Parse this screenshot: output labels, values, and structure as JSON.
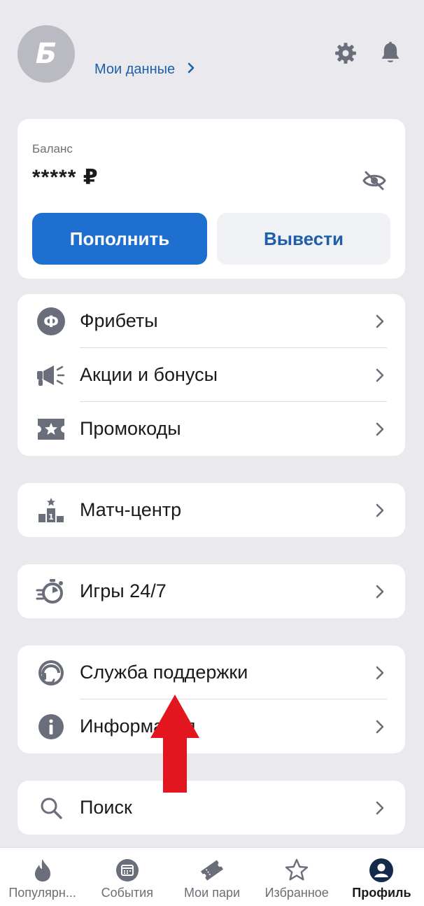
{
  "header": {
    "avatar_letter": "Б",
    "my_data_label": "Мои данные",
    "icons": [
      "gear-icon",
      "bell-icon"
    ]
  },
  "balance": {
    "label": "Баланс",
    "value": "***** ₽",
    "deposit_label": "Пополнить",
    "withdraw_label": "Вывести"
  },
  "menu": {
    "group1": [
      {
        "label": "Фрибеты",
        "icon": "freebet-icon"
      },
      {
        "label": "Акции и бонусы",
        "icon": "megaphone-icon"
      },
      {
        "label": "Промокоды",
        "icon": "promo-ticket-icon"
      }
    ],
    "group2": [
      {
        "label": "Матч-центр",
        "icon": "podium-icon"
      }
    ],
    "group3": [
      {
        "label": "Игры 24/7",
        "icon": "stopwatch-icon"
      }
    ],
    "group4": [
      {
        "label": "Служба поддержки",
        "icon": "support-chat-icon"
      },
      {
        "label": "Информация",
        "icon": "info-icon"
      }
    ],
    "group5": [
      {
        "label": "Поиск",
        "icon": "search-icon"
      }
    ]
  },
  "tabbar": {
    "items": [
      {
        "label": "Популярн...",
        "icon": "flame-icon"
      },
      {
        "label": "События",
        "icon": "calendar-icon"
      },
      {
        "label": "Мои пари",
        "icon": "ticket-icon"
      },
      {
        "label": "Избранное",
        "icon": "star-icon"
      },
      {
        "label": "Профиль",
        "icon": "profile-icon",
        "active": true
      }
    ]
  },
  "colors": {
    "accent": "#1f6fd0",
    "link": "#1d5fa8",
    "background": "#e9e9ee",
    "icon_gray": "#6a6d7a",
    "annotation_arrow": "#e3151f"
  }
}
